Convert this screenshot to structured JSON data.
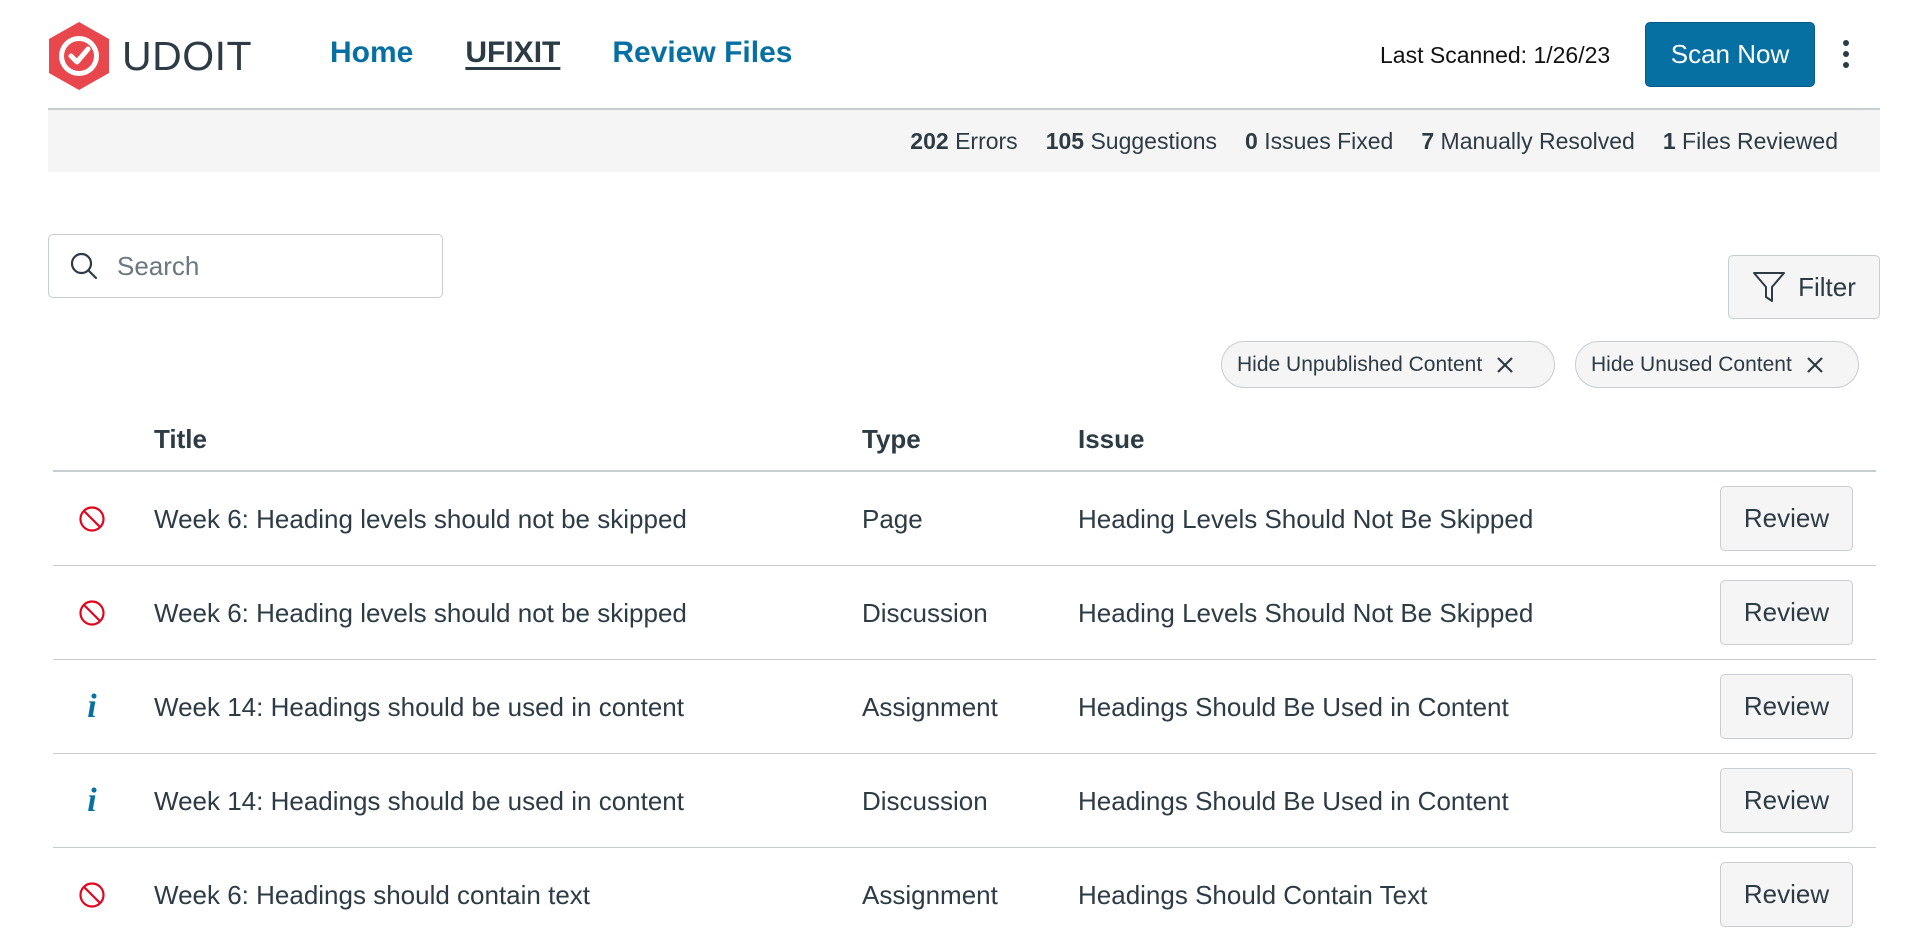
{
  "app": {
    "name": "UDOIT",
    "colors": {
      "brand": "#e8474d",
      "accent": "#0770a3",
      "error": "#e0061f"
    }
  },
  "nav": [
    {
      "label": "Home",
      "active": false
    },
    {
      "label": "UFIXIT",
      "active": true
    },
    {
      "label": "Review Files",
      "active": false
    }
  ],
  "header": {
    "last_scanned": "Last Scanned: 1/26/23",
    "scan_button": "Scan Now",
    "menu_icon": "kebab-menu-icon"
  },
  "summary": [
    {
      "count": "202",
      "label": "Errors"
    },
    {
      "count": "105",
      "label": "Suggestions"
    },
    {
      "count": "0",
      "label": "Issues Fixed"
    },
    {
      "count": "7",
      "label": "Manually Resolved"
    },
    {
      "count": "1",
      "label": "Files Reviewed"
    }
  ],
  "search": {
    "placeholder": "Search",
    "value": ""
  },
  "filter_button": "Filter",
  "active_filters": [
    "Hide Unpublished Content",
    "Hide Unused Content"
  ],
  "table": {
    "columns": [
      "Title",
      "Type",
      "Issue"
    ],
    "rows": [
      {
        "icon": "error",
        "title": "Week 6: Heading levels should not be skipped",
        "type": "Page",
        "issue": "Heading Levels Should Not Be Skipped",
        "action": "Review"
      },
      {
        "icon": "error",
        "title": "Week 6: Heading levels should not be skipped",
        "type": "Discussion",
        "issue": "Heading Levels Should Not Be Skipped",
        "action": "Review"
      },
      {
        "icon": "info",
        "title": "Week 14: Headings should be used in content",
        "type": "Assignment",
        "issue": "Headings Should Be Used in Content",
        "action": "Review"
      },
      {
        "icon": "info",
        "title": "Week 14: Headings should be used in content",
        "type": "Discussion",
        "issue": "Headings Should Be Used in Content",
        "action": "Review"
      },
      {
        "icon": "error",
        "title": "Week 6: Headings should contain text",
        "type": "Assignment",
        "issue": "Headings Should Contain Text",
        "action": "Review"
      }
    ]
  }
}
